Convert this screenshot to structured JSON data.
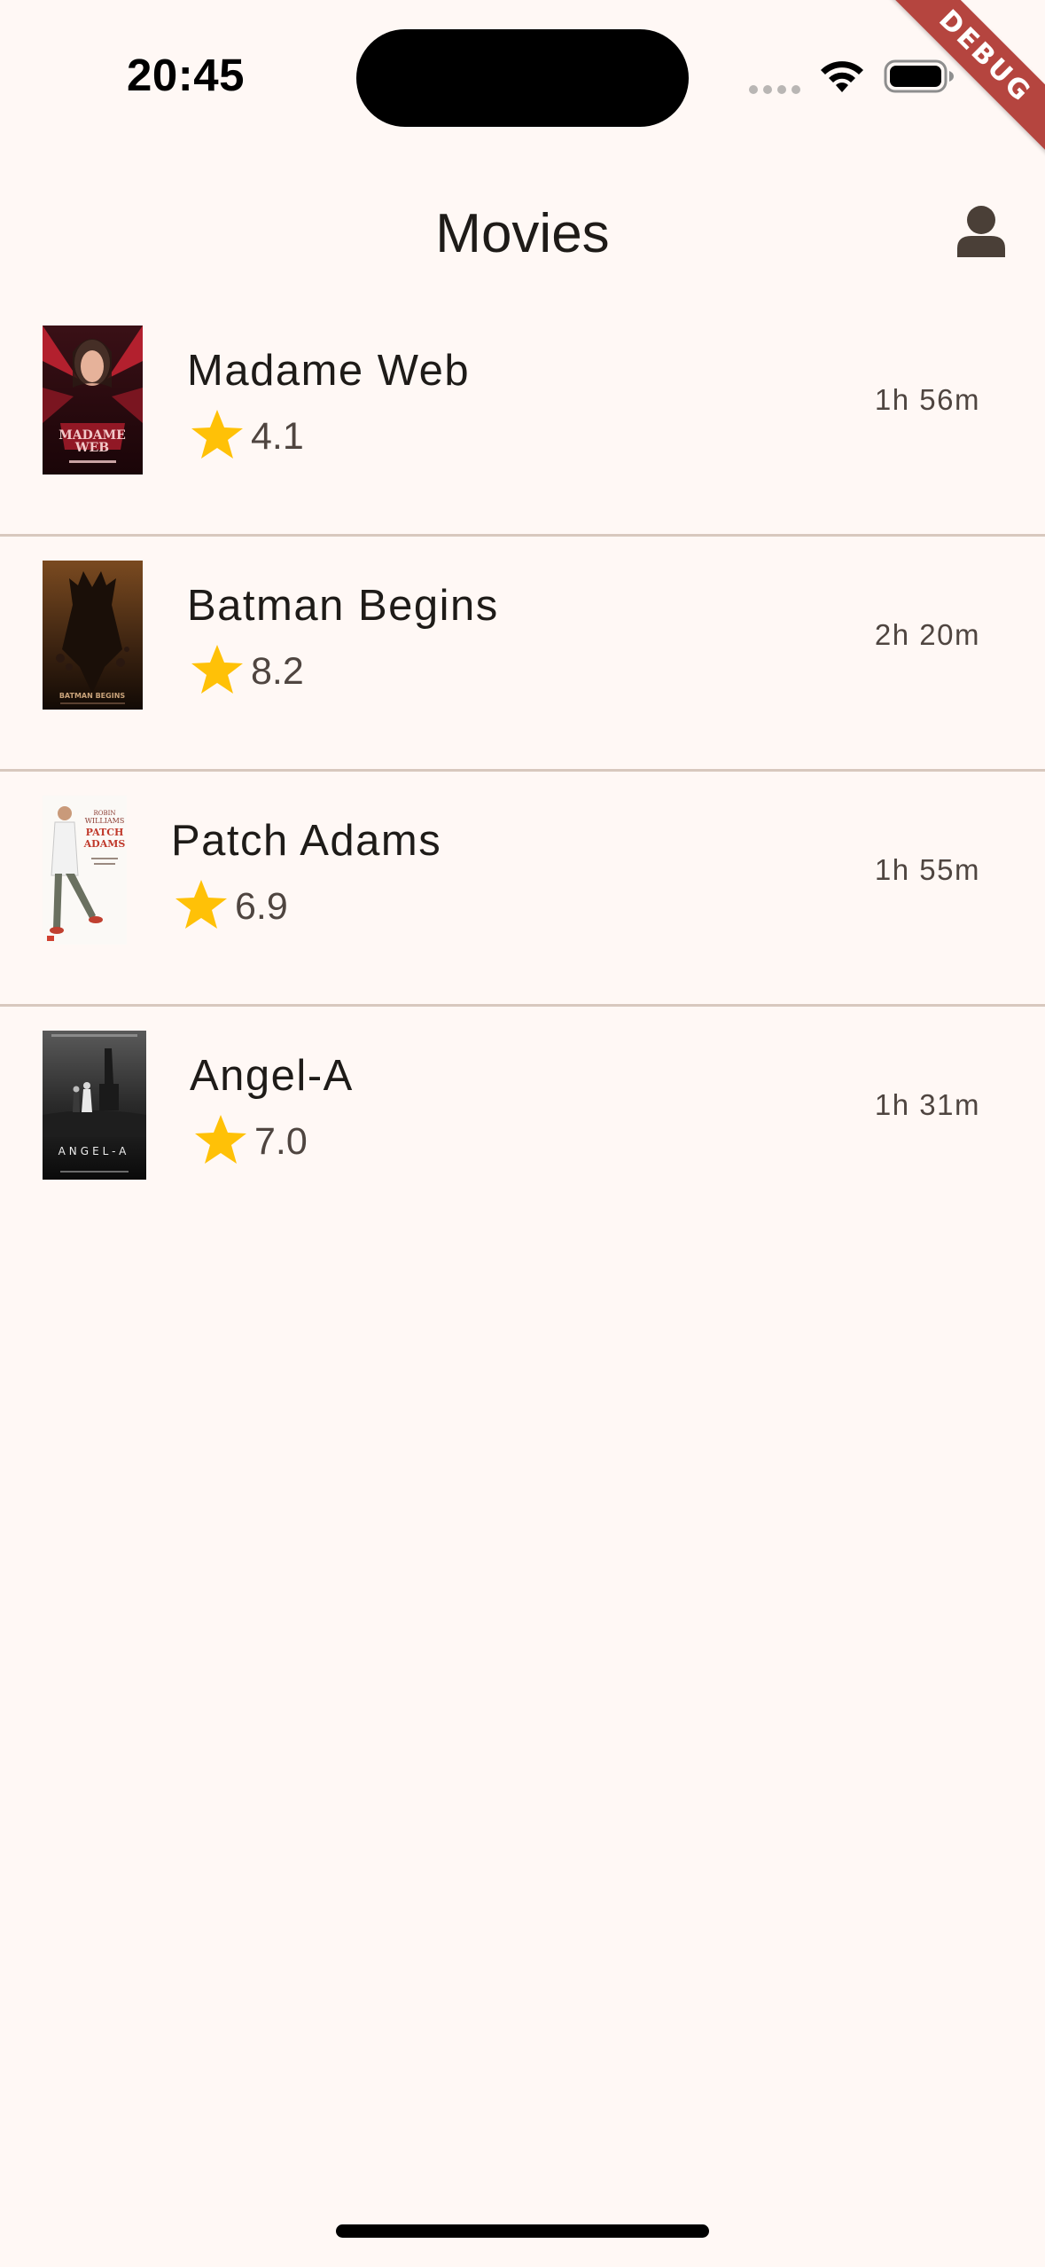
{
  "status_bar": {
    "time": "20:45"
  },
  "debug_banner": {
    "label": "DEBUG",
    "color": "#B5453F"
  },
  "app_bar": {
    "title": "Movies",
    "profile_icon": "person-icon"
  },
  "colors": {
    "background": "#FFF8F5",
    "divider": "#D8C8BE",
    "star": "#FFC107",
    "secondary_text": "#4F4540"
  },
  "movies": [
    {
      "title": "Madame Web",
      "rating": "4.1",
      "duration": "1h 56m",
      "poster_icon": "madame-web-poster"
    },
    {
      "title": "Batman Begins",
      "rating": "8.2",
      "duration": "2h 20m",
      "poster_icon": "batman-begins-poster"
    },
    {
      "title": "Patch Adams",
      "rating": "6.9",
      "duration": "1h 55m",
      "poster_icon": "patch-adams-poster"
    },
    {
      "title": "Angel-A",
      "rating": "7.0",
      "duration": "1h 31m",
      "poster_icon": "angel-a-poster"
    }
  ]
}
